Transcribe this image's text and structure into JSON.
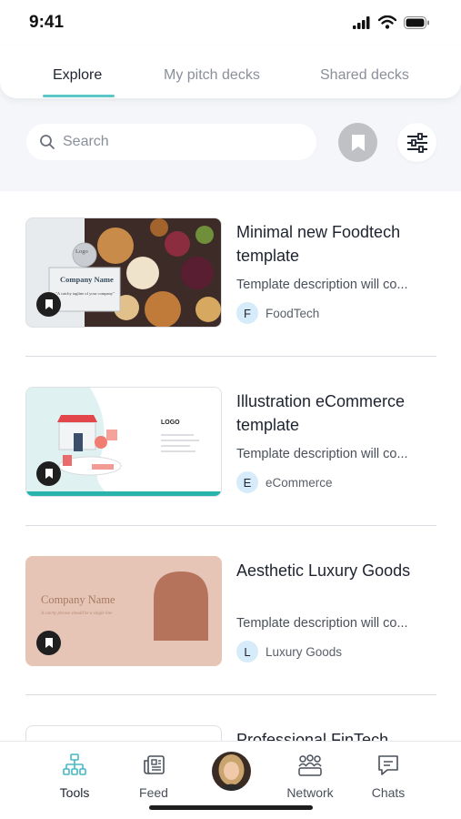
{
  "status_bar": {
    "time": "9:41"
  },
  "tabs": [
    {
      "label": "Explore",
      "active": true
    },
    {
      "label": "My pitch decks",
      "active": false
    },
    {
      "label": "Shared decks",
      "active": false
    }
  ],
  "search": {
    "placeholder": "Search",
    "value": ""
  },
  "colors": {
    "accent": "#5cc7c8",
    "badge_bg": "#d6ecfb",
    "bookmark_active": "#bfc1c4"
  },
  "templates": [
    {
      "title": "Minimal new Foodtech template",
      "description": "Template description will co...",
      "category_initial": "F",
      "category": "FoodTech",
      "thumb": {
        "logo": "Logo",
        "company": "Company Name",
        "tagline": "\"A catchy tagline of your company\""
      }
    },
    {
      "title": "Illustration eCommerce template",
      "description": "Template description will co...",
      "category_initial": "E",
      "category": "eCommerce",
      "thumb": {
        "logo": "LOGO"
      }
    },
    {
      "title": "Aesthetic Luxury Goods",
      "description": "Template description will co...",
      "category_initial": "L",
      "category": "Luxury Goods",
      "thumb": {
        "company": "Company Name",
        "tagline": "A catchy phrase should be a single line"
      }
    },
    {
      "title": "Professional FinTech"
    }
  ],
  "nav": [
    {
      "label": "Tools",
      "icon": "hierarchy-icon",
      "active": true
    },
    {
      "label": "Feed",
      "icon": "feed-icon",
      "active": false
    },
    {
      "label": "",
      "icon": "avatar",
      "active": false
    },
    {
      "label": "Network",
      "icon": "network-icon",
      "active": false
    },
    {
      "label": "Chats",
      "icon": "chat-icon",
      "active": false
    }
  ]
}
